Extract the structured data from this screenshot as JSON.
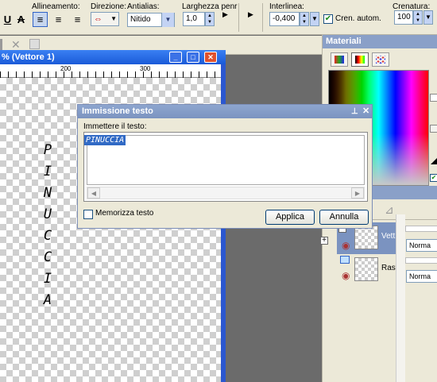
{
  "toolbar": {
    "allineamento_label": "Allineamento:",
    "direzione_label": "Direzione:",
    "antialias_label": "Antialias:",
    "antialias_value": "Nitido",
    "larghezza_label": "Larghezza penr",
    "larghezza_value": "1,0",
    "interlinea_label": "Interlinea:",
    "interlinea_value": "-0,400",
    "cren_label": "Cren. autom.",
    "crenatura_label": "Crenatura:",
    "crenatura_value": "100"
  },
  "document": {
    "title": "% (Vettore 1)",
    "ruler_200": "200",
    "ruler_300": "300",
    "vertical_text": [
      "P",
      "I",
      "N",
      "U",
      "C",
      "C",
      "I",
      "A"
    ]
  },
  "materials": {
    "title": "Materiali"
  },
  "layers": {
    "row1_label": "Vett",
    "row2_label": "Rast",
    "blend1": "Norma",
    "blend2": "Norma"
  },
  "dialog": {
    "title": "Immissione testo",
    "prompt": "Immettere il testo:",
    "text_value": "PINUCCIA",
    "remember_label": "Memorizza testo",
    "apply_label": "Applica",
    "cancel_label": "Annulla"
  }
}
